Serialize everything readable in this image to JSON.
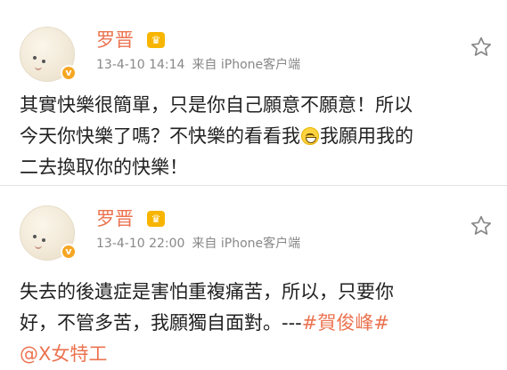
{
  "posts": [
    {
      "username": "罗晋",
      "badge_icon": "crown-vip-icon",
      "verified_icon": "verified-v-icon",
      "timestamp": "13-4-10 14:14",
      "source": "来自 iPhone客户端",
      "favorite_icon": "star-icon",
      "lines": [
        "其實快樂很簡單，只是你自己願意不願意！所以",
        "今天你快樂了嗎？不快樂的看看我",
        "我願用我的",
        "二去換取你的快樂！"
      ],
      "emoji": "grin-emoji-icon"
    },
    {
      "username": "罗晋",
      "badge_icon": "crown-vip-icon",
      "verified_icon": "verified-v-icon",
      "timestamp": "13-4-10 22:00",
      "source": "来自 iPhone客户端",
      "favorite_icon": "star-icon",
      "lines": [
        "失去的後遺症是害怕重複痛苦，所以，只要你",
        "好，不管多苦，我願獨自面對。---",
        "#賀俊峰#",
        "@X女特工"
      ]
    }
  ],
  "colors": {
    "accent": "#eb7350",
    "meta": "#888888",
    "text": "#222222",
    "crown": "#f7b500",
    "verified": "#f5a623"
  }
}
